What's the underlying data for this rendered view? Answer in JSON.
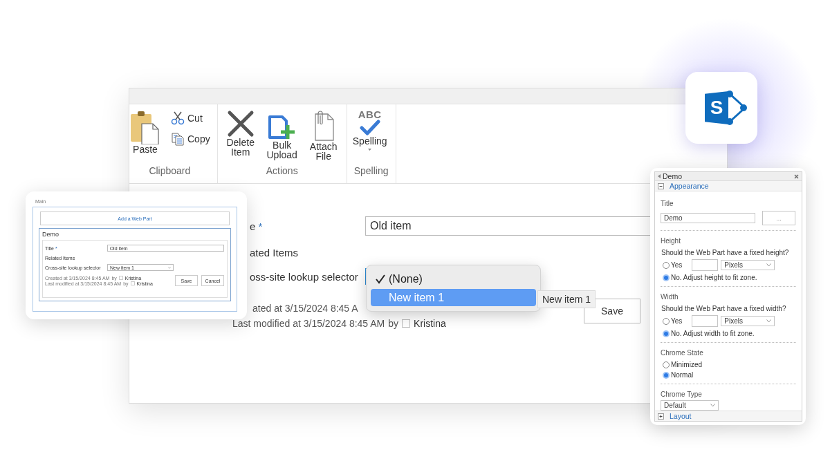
{
  "logo_tile": {
    "letter": "S"
  },
  "main_window": {
    "ribbon": {
      "groups": [
        {
          "label": "Clipboard",
          "commands": [
            {
              "kind": "large",
              "label": "Paste"
            },
            {
              "kind": "small",
              "label": "Cut"
            },
            {
              "kind": "small",
              "label": "Copy"
            }
          ]
        },
        {
          "label": "Actions",
          "commands": [
            {
              "kind": "large",
              "label": "Delete Item"
            },
            {
              "kind": "large",
              "label": "Bulk Upload"
            },
            {
              "kind": "large",
              "label": "Attach File"
            }
          ]
        },
        {
          "label": "Spelling",
          "commands": [
            {
              "kind": "split",
              "icon_text": "ABC",
              "label": "Spelling"
            }
          ]
        }
      ]
    },
    "form": {
      "title_label": "e",
      "required_mark": "*",
      "title_value": "Old item",
      "related_label": "ated Items",
      "lookup_label": "oss-site lookup selector",
      "created": "ated at 3/15/2024 8:45 A",
      "modified": "Last modified at 3/15/2024 8:45 AM",
      "modified_by": "by",
      "modified_user": "Kristina",
      "save": "Save"
    }
  },
  "dropdown_menu": {
    "options": [
      {
        "label": "(None)",
        "checked": true,
        "highlighted": false
      },
      {
        "label": "New item 1",
        "checked": false,
        "highlighted": true
      }
    ]
  },
  "tooltip": "New item 1",
  "preview_card": {
    "zone_label": "Main",
    "add_web_part": "Add a Web Part",
    "web_part_title": "Demo",
    "title_label": "Title",
    "required_mark": "*",
    "title_value": "Old item",
    "related_label": "Related Items",
    "lookup_label": "Cross-site lookup selector",
    "lookup_value": "New item 1",
    "info_lines": [
      {
        "text": "Created at 3/15/2024 8:45 AM",
        "by": "by",
        "user": "Kristina"
      },
      {
        "text": "Last modified at 3/15/2024 8:45 AM",
        "by": "by",
        "user": "Kristina"
      }
    ],
    "buttons": [
      "Save",
      "Cancel"
    ]
  },
  "web_part_panel": {
    "title": "Demo",
    "appearance": {
      "label": "Appearance",
      "expanded": true
    },
    "title_field": {
      "label": "Title",
      "value": "Demo",
      "button": "..."
    },
    "size_settings": [
      {
        "label": "Height",
        "question": "Should the Web Part have a fixed height?",
        "unit": "Pixels",
        "options": [
          {
            "kind": "sized",
            "label": "Yes",
            "selected": false
          },
          {
            "kind": "plain",
            "label": "No. Adjust height to fit zone.",
            "selected": true
          }
        ]
      },
      {
        "label": "Width",
        "question": "Should the Web Part have a fixed width?",
        "unit": "Pixels",
        "options": [
          {
            "kind": "sized",
            "label": "Yes",
            "selected": false
          },
          {
            "kind": "plain",
            "label": "No. Adjust width to fit zone.",
            "selected": true
          }
        ]
      }
    ],
    "chrome_state": {
      "label": "Chrome State",
      "options": [
        {
          "label": "Minimized",
          "selected": false
        },
        {
          "label": "Normal",
          "selected": true
        }
      ]
    },
    "chrome_type": {
      "label": "Chrome Type",
      "value": "Default"
    },
    "layout": {
      "label": "Layout",
      "expanded": false
    }
  }
}
